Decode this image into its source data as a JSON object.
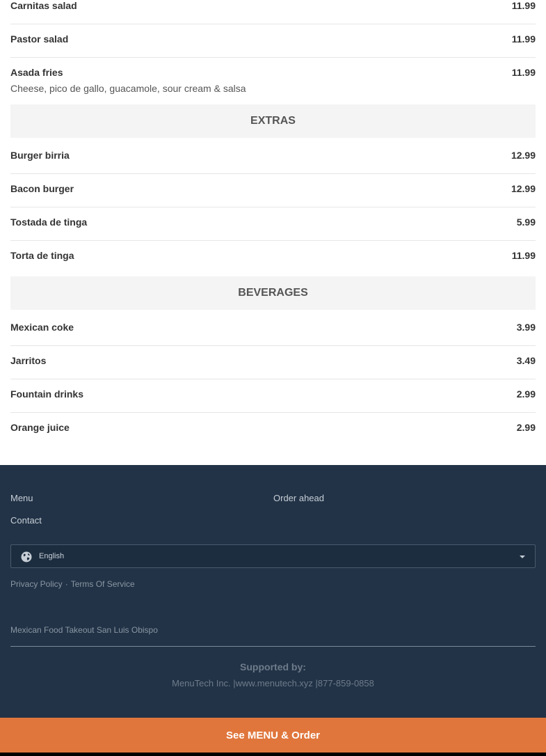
{
  "menu": {
    "items_top": [
      {
        "name": "Carnitas salad",
        "price": "11.99",
        "desc": ""
      },
      {
        "name": "Pastor salad",
        "price": "11.99",
        "desc": ""
      },
      {
        "name": "Asada fries",
        "price": "11.99",
        "desc": "Cheese, pico de gallo, guacamole, sour cream & salsa"
      }
    ],
    "extras_title": "EXTRAS",
    "extras": [
      {
        "name": "Burger birria",
        "price": "12.99"
      },
      {
        "name": "Bacon burger",
        "price": "12.99"
      },
      {
        "name": "Tostada de tinga",
        "price": "5.99"
      },
      {
        "name": "Torta de tinga",
        "price": "11.99"
      }
    ],
    "beverages_title": "BEVERAGES",
    "beverages": [
      {
        "name": "Mexican coke",
        "price": "3.99"
      },
      {
        "name": "Jarritos",
        "price": "3.49"
      },
      {
        "name": "Fountain drinks",
        "price": "2.99"
      },
      {
        "name": "Orange juice",
        "price": "2.99"
      }
    ]
  },
  "footer": {
    "links": {
      "menu": "Menu",
      "order_ahead": "Order ahead",
      "contact": "Contact"
    },
    "language": {
      "selected": "English",
      "icon": "globe-icon"
    },
    "legal": {
      "privacy": "Privacy Policy",
      "separator": "·",
      "terms": "Terms Of Service"
    },
    "tagline": "Mexican Food Takeout San Luis Obispo",
    "supported_by": "Supported by:",
    "company_line": "MenuTech Inc. |www.menutech.xyz |877-859-0858"
  },
  "cta": {
    "label": "See MENU & Order"
  },
  "colors": {
    "footer_bg": "#223347",
    "cta_bg": "#e0763c",
    "section_bg": "#f4f4f4"
  }
}
